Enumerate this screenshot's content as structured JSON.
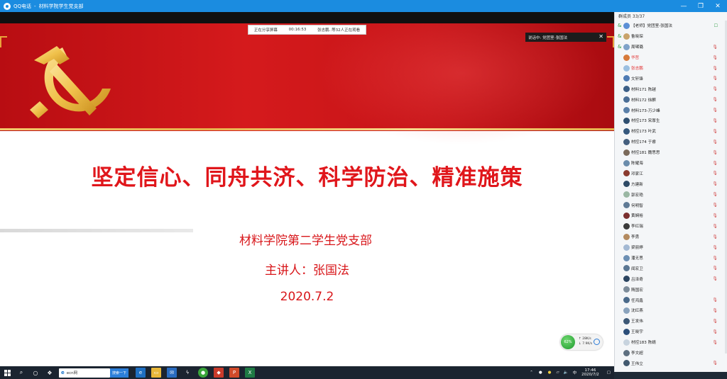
{
  "titlebar": {
    "app": "QQ电话",
    "sep": "-",
    "group": "材料学院学生党支部"
  },
  "window_controls": [
    "—",
    "❐",
    "✕"
  ],
  "share_bar": {
    "status": "正在分享屏幕",
    "timer": "00:16:53",
    "viewers": "张志鹏..等32人正在观看"
  },
  "speaking": {
    "text": "说话中: 党团室-张国法",
    "close": "✕"
  },
  "slide": {
    "title": "坚定信心、同舟共济、科学防治、精准施策",
    "org": "材料学院第二学生党支部",
    "speaker": "主讲人：张国法",
    "date": "2020.7.2"
  },
  "net_widget": {
    "percent": "62%",
    "up": "↑ 28K/s",
    "down": "↓ 7.9K/s"
  },
  "taskbar": {
    "search_value": "ecn网",
    "search_button": "搜索一下",
    "clock_time": "17:46",
    "clock_date": "2020/7/2"
  },
  "panel": {
    "header": "群成员 33/37",
    "members": [
      {
        "name": "【老师】党团室-张国法",
        "flag": "&",
        "mic": "☐",
        "color": "#5b8fd6"
      },
      {
        "name": "鲁晓琛",
        "flag": "&",
        "mic": "",
        "color": "#c9a36b"
      },
      {
        "name": "周珺璐",
        "flag": "&",
        "mic": "🎙",
        "color": "#7fa2c9"
      },
      {
        "name": "华哲",
        "flag": "",
        "mic": "🎙",
        "color": "#d77a3a",
        "red": true
      },
      {
        "name": "张志鹏",
        "flag": "",
        "mic": "🎙",
        "color": "#9bbfe0",
        "red": true
      },
      {
        "name": "文轩锋",
        "flag": "",
        "mic": "🎙",
        "color": "#4d7ab3"
      },
      {
        "name": "材料171 陈越",
        "flag": "",
        "mic": "🎙",
        "color": "#3b5e86"
      },
      {
        "name": "材料172 徐麒",
        "flag": "",
        "mic": "🎙",
        "color": "#4b6e96"
      },
      {
        "name": "材料173-万少峰",
        "flag": "",
        "mic": "🎙",
        "color": "#5a7fa8"
      },
      {
        "name": "材控173 宋厚生",
        "flag": "",
        "mic": "🎙",
        "color": "#2f4f70"
      },
      {
        "name": "材控173 叶武",
        "flag": "",
        "mic": "🎙",
        "color": "#35587d"
      },
      {
        "name": "材控174 于睿",
        "flag": "",
        "mic": "🎙",
        "color": "#445f7e"
      },
      {
        "name": "材控181 魏思思",
        "flag": "",
        "mic": "🎙",
        "color": "#7b6a5a"
      },
      {
        "name": "陈耀海",
        "flag": "",
        "mic": "🎙",
        "color": "#6a8cab"
      },
      {
        "name": "邓家江",
        "flag": "",
        "mic": "🎙",
        "color": "#8b3b2f"
      },
      {
        "name": "方建新",
        "flag": "",
        "mic": "🎙",
        "color": "#2e4a66"
      },
      {
        "name": "郭宏艳",
        "flag": "",
        "mic": "🎙",
        "color": "#9ab7a3"
      },
      {
        "name": "何明智",
        "flag": "",
        "mic": "🎙",
        "color": "#5f7a95"
      },
      {
        "name": "黄娴裕",
        "flag": "",
        "mic": "🎙",
        "color": "#7a2f2f"
      },
      {
        "name": "李红瑞",
        "flag": "",
        "mic": "🎙",
        "color": "#3a3a3a"
      },
      {
        "name": "李勇",
        "flag": "",
        "mic": "🎙",
        "color": "#b38a5f"
      },
      {
        "name": "梁丽婷",
        "flag": "",
        "mic": "🎙",
        "color": "#a3b9d3"
      },
      {
        "name": "潘无思",
        "flag": "",
        "mic": "🎙",
        "color": "#6c8fb3"
      },
      {
        "name": "闻宏卫",
        "flag": "",
        "mic": "🎙",
        "color": "#5a7692"
      },
      {
        "name": "吕泽奇",
        "flag": "",
        "mic": "🎙",
        "color": "#2a4460"
      },
      {
        "name": "隋国宏",
        "flag": "",
        "mic": "",
        "color": "#7d8c9a"
      },
      {
        "name": "任鸿鑫",
        "flag": "",
        "mic": "🎙",
        "color": "#4a6a8a"
      },
      {
        "name": "沈红燕",
        "flag": "",
        "mic": "🎙",
        "color": "#8aa3bd"
      },
      {
        "name": "王发伟",
        "flag": "",
        "mic": "🎙",
        "color": "#3c5876"
      },
      {
        "name": "王晓宇",
        "flag": "",
        "mic": "🎙",
        "color": "#2b4e79"
      },
      {
        "name": "材控183 陈婧",
        "flag": "",
        "mic": "🎙",
        "color": "#c7d3de"
      },
      {
        "name": "李文超",
        "flag": "",
        "mic": "",
        "color": "#5d6f80"
      },
      {
        "name": "王伟立",
        "flag": "",
        "mic": "🎙",
        "color": "#41596f"
      }
    ]
  }
}
